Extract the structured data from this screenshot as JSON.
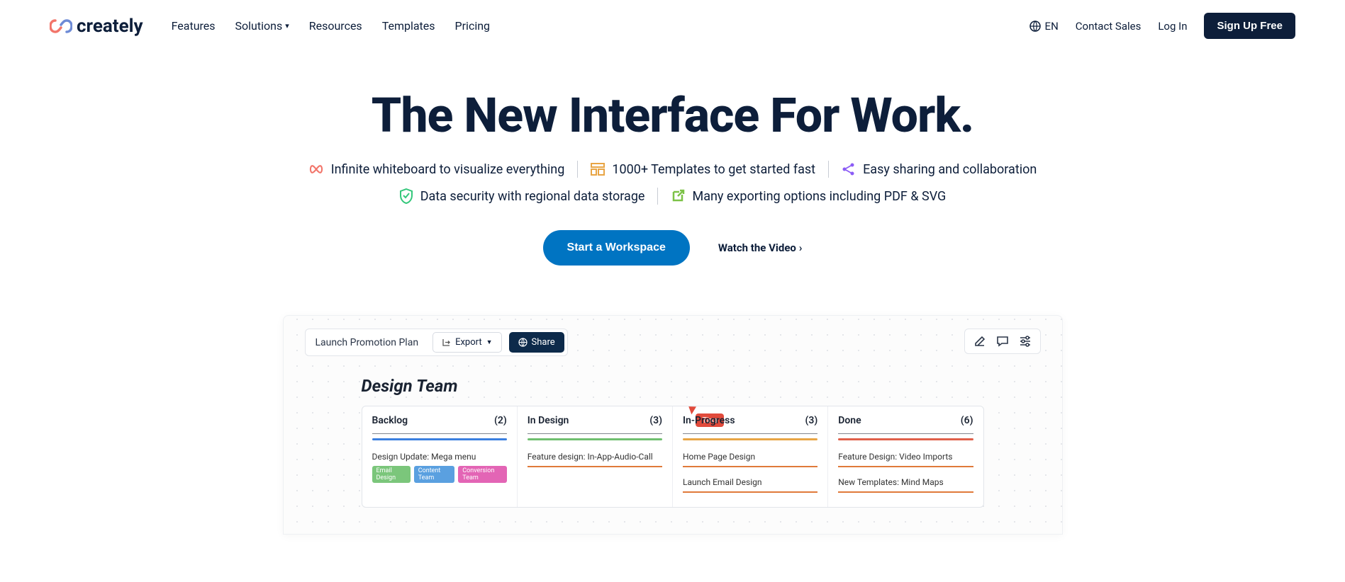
{
  "brand": "creately",
  "nav": [
    "Features",
    "Solutions",
    "Resources",
    "Templates",
    "Pricing"
  ],
  "lang": "EN",
  "contact": "Contact Sales",
  "login": "Log In",
  "signup": "Sign Up Free",
  "hero": "The New Interface For Work.",
  "features": [
    "Infinite whiteboard to visualize everything",
    "1000+ Templates to get started fast",
    "Easy sharing and collaboration",
    "Data security with regional data storage",
    "Many exporting options including PDF & SVG"
  ],
  "cta": "Start a Workspace",
  "watch": "Watch the Video",
  "mock": {
    "title": "Launch Promotion Plan",
    "export": "Export",
    "share": "Share",
    "board": "Design Team",
    "cursor": "Tina",
    "columns": [
      {
        "name": "Backlog",
        "count": "(2)",
        "bar": "#3b7fe0",
        "cards": [
          {
            "title": "Design Update: Mega menu",
            "tags": [
              {
                "text": "Email Design",
                "color": "#7bc67b"
              },
              {
                "text": "Content Team",
                "color": "#5aa0e0"
              },
              {
                "text": "Conversion Team",
                "color": "#e365b5"
              }
            ]
          }
        ]
      },
      {
        "name": "In Design",
        "count": "(3)",
        "bar": "#6fbf6f",
        "cards": [
          {
            "title": "Feature design: In-App-Audio-Call"
          }
        ]
      },
      {
        "name": "In-Progress",
        "count": "(3)",
        "bar": "#e8a545",
        "cards": [
          {
            "title": "Home Page Design"
          },
          {
            "title": "Launch Email Design"
          }
        ]
      },
      {
        "name": "Done",
        "count": "(6)",
        "bar": "#e0604a",
        "cards": [
          {
            "title": "Feature Design: Video Imports"
          },
          {
            "title": "New Templates: Mind Maps"
          }
        ]
      }
    ]
  }
}
